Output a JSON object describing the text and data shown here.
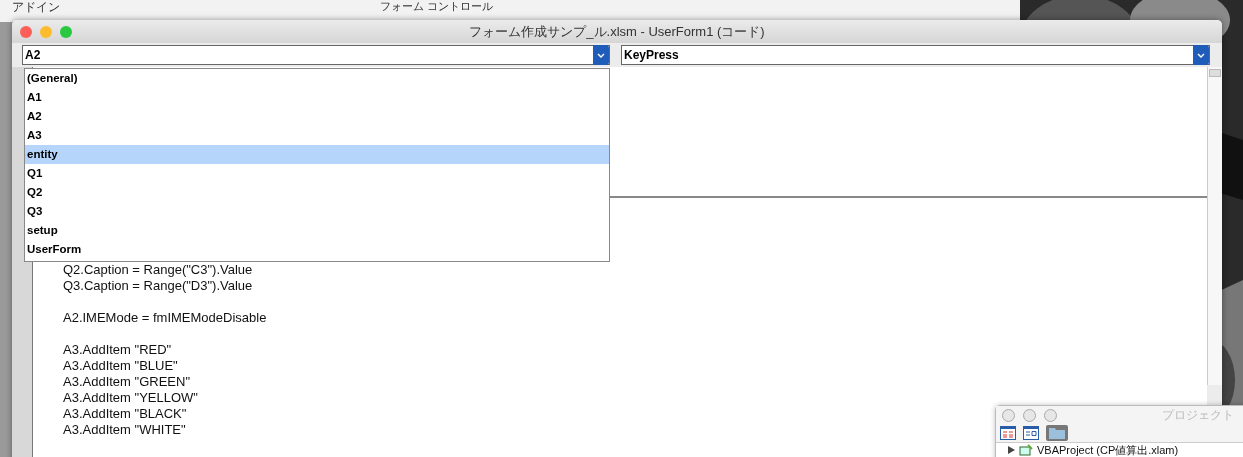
{
  "background": {
    "ribbon_tab": "アドイン",
    "ribbon_group": "フォーム コントロール"
  },
  "code_window": {
    "title": "フォーム作成サンプ_ル.xlsm - UserForm1 (コード)",
    "object_combo": "A2",
    "procedure_combo": "KeyPress",
    "object_list": [
      {
        "label": "(General)",
        "selected": false
      },
      {
        "label": "A1",
        "selected": false
      },
      {
        "label": "A2",
        "selected": false
      },
      {
        "label": "A3",
        "selected": false
      },
      {
        "label": "entity",
        "selected": true
      },
      {
        "label": "Q1",
        "selected": false
      },
      {
        "label": "Q2",
        "selected": false
      },
      {
        "label": "Q3",
        "selected": false
      },
      {
        "label": "setup",
        "selected": false
      },
      {
        "label": "UserForm",
        "selected": false
      }
    ],
    "code_blocks": [
      [
        "Q2.Caption = Range(\"C3\").Value",
        "Q3.Caption = Range(\"D3\").Value"
      ],
      [
        "A2.IMEMode = fmIMEModeDisable"
      ],
      [
        "A3.AddItem \"RED\"",
        "A3.AddItem \"BLUE\"",
        "A3.AddItem \"GREEN\"",
        "A3.AddItem \"YELLOW\"",
        "A3.AddItem \"BLACK\"",
        "A3.AddItem \"WHITE\""
      ]
    ]
  },
  "project_window": {
    "title": "プロジェクト",
    "tree": [
      {
        "label": "VBAProject (CP値算出.xlam)",
        "expanded": false
      }
    ]
  }
}
